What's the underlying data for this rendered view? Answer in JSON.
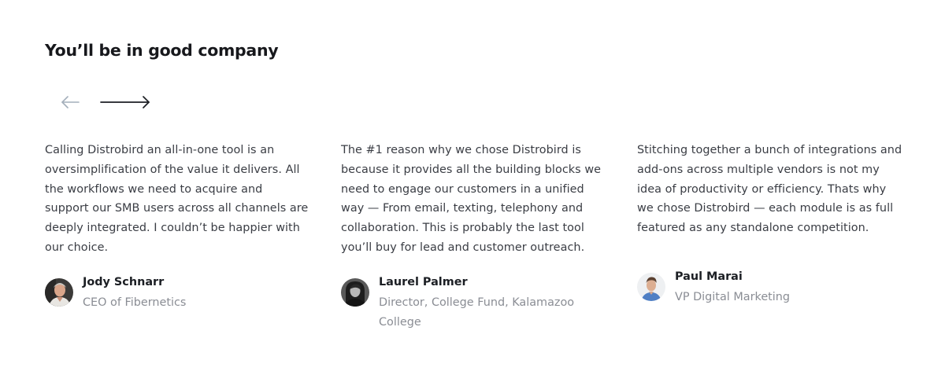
{
  "heading": "You’ll be in good company",
  "nav": {
    "prev_icon": "arrow-left-icon",
    "next_icon": "arrow-right-icon",
    "prev_color": "#a4afbb",
    "next_color": "#1c1f24"
  },
  "testimonials": [
    {
      "quote_lines": [
        "Calling Distrobird an all-in-one tool is an",
        "oversimplification of the value it delivers. All",
        "the workflows we need to acquire and",
        "support our SMB users across all channels are",
        "deeply integrated. I couldn’t be happier with",
        "our choice."
      ],
      "name": "Jody Schnarr",
      "role_lines": [
        "CEO of Fibernetics"
      ]
    },
    {
      "quote_lines": [
        "The #1 reason why we chose Distrobird is",
        "because it provides all the building blocks we",
        "need to engage our customers in a unified",
        "way — From email, texting, telephony and",
        "collaboration. This is probably the last tool",
        "you’ll buy for lead and customer outreach."
      ],
      "name": "Laurel Palmer",
      "role_lines": [
        "Director, College Fund, Kalamazoo",
        "College"
      ]
    },
    {
      "quote_lines": [
        "Stitching together a bunch of integrations and",
        "add-ons across multiple vendors is not my",
        "idea of productivity or efficiency. Thats why",
        "we chose Distrobird — each module is as full",
        "featured as any standalone competition."
      ],
      "name": "Paul Marai",
      "role_lines": [
        "VP Digital Marketing"
      ]
    }
  ]
}
